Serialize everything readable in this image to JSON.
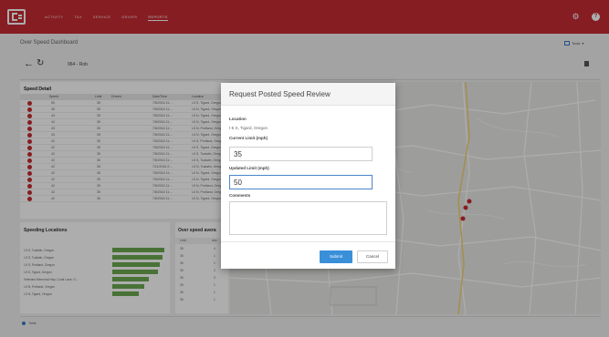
{
  "nav": {
    "items": [
      "ACTIVITY",
      "TAX",
      "SERVICE",
      "DRIVER",
      "REPORTS"
    ],
    "active": "REPORTS"
  },
  "page": {
    "title": "Over Speed Dashboard",
    "tools_label": "Tools",
    "vehicle": "964 - Rob"
  },
  "speed_detail": {
    "title": "Speed Detail",
    "columns": [
      "Speed",
      "Limit",
      "Drivers",
      "Date/Time",
      "Location"
    ],
    "rows": [
      {
        "speed": "50",
        "limit": "35",
        "driver": "",
        "datetime": "7/8/2016 11:...",
        "location": "I-5 S, Tigard, Oregon"
      },
      {
        "speed": "45",
        "limit": "35",
        "driver": "",
        "datetime": "7/8/2016 11:...",
        "location": "I-5 N, Tigard, Oregon"
      },
      {
        "speed": "44",
        "limit": "35",
        "driver": "",
        "datetime": "7/8/2016 11:...",
        "location": "I-5 N, Tigard, Oregon"
      },
      {
        "speed": "44",
        "limit": "35",
        "driver": "",
        "datetime": "7/8/2016 11:...",
        "location": "I-5 N, Tigard, Oregon"
      },
      {
        "speed": "43",
        "limit": "35",
        "driver": "",
        "datetime": "7/8/2016 11:...",
        "location": "I-5 N, Portland, Oregon"
      },
      {
        "speed": "43",
        "limit": "35",
        "driver": "",
        "datetime": "7/8/2016 11:...",
        "location": "I-5 N, Tigard, Oregon"
      },
      {
        "speed": "42",
        "limit": "35",
        "driver": "",
        "datetime": "7/8/2016 11:...",
        "location": "I-5 S, Portland, Oregon"
      },
      {
        "speed": "42",
        "limit": "35",
        "driver": "",
        "datetime": "7/8/2016 11:...",
        "location": "I-5 S, Tigard, Oregon"
      },
      {
        "speed": "42",
        "limit": "35",
        "driver": "",
        "datetime": "7/8/2016 11:...",
        "location": "I-5 S, Tualatin, Oregon"
      },
      {
        "speed": "42",
        "limit": "35",
        "driver": "",
        "datetime": "7/8/2016 11:...",
        "location": "I-5 S, Tualatin, Oregon"
      },
      {
        "speed": "42",
        "limit": "35",
        "driver": "",
        "datetime": "7/11/2016 2:...",
        "location": "I-5 N, Tualatin, Oregon"
      },
      {
        "speed": "42",
        "limit": "35",
        "driver": "",
        "datetime": "7/8/2016 11:...",
        "location": "I-5 N, Tigard, Oregon"
      },
      {
        "speed": "42",
        "limit": "35",
        "driver": "",
        "datetime": "7/8/2016 11:...",
        "location": "I-5 N, Tigard, Oregon"
      },
      {
        "speed": "42",
        "limit": "35",
        "driver": "",
        "datetime": "7/8/2016 11:...",
        "location": "I-5 N, Portland, Oregon"
      },
      {
        "speed": "42",
        "limit": "35",
        "driver": "",
        "datetime": "7/8/2016 11:...",
        "location": "I-5 N, Portland, Oregon"
      },
      {
        "speed": "42",
        "limit": "35",
        "driver": "",
        "datetime": "7/8/2016 11:...",
        "location": "I-5 N, Tigard, Oregon"
      }
    ]
  },
  "speeding_locations": {
    "title": "Speeding Locations",
    "items": [
      {
        "label": "I-5 S, Tualatin, Oregon",
        "value": 1.0
      },
      {
        "label": "I-5 S, Tualatin, Oregon",
        "value": 0.96
      },
      {
        "label": "I-5 S, Portland, Oregon",
        "value": 0.92
      },
      {
        "label": "I-5 S, Tigard, Oregon",
        "value": 0.88
      },
      {
        "label": "Veterans Memorial Hwy, Coral Lane, O...",
        "value": 0.7
      },
      {
        "label": "I-5 N, Portland, Oregon",
        "value": 0.62
      },
      {
        "label": "I-5 N, Tigard, Oregon",
        "value": 0.5
      }
    ]
  },
  "over_speed": {
    "title": "Over speed avera",
    "columns": [
      "Limit",
      "Ave"
    ],
    "rows": [
      {
        "limit": "35",
        "avg": "4"
      },
      {
        "limit": "35",
        "avg": "1"
      },
      {
        "limit": "35",
        "avg": "1"
      },
      {
        "limit": "35",
        "avg": "2"
      },
      {
        "limit": "35",
        "avg": "3"
      },
      {
        "limit": "35",
        "avg": "1"
      },
      {
        "limit": "35",
        "avg": "1"
      },
      {
        "limit": "35",
        "avg": "1"
      }
    ]
  },
  "footer": {
    "legend_label": "Total"
  },
  "modal": {
    "title": "Request Posted Speed Review",
    "location_label": "Location",
    "location_value": "I-5 S, Tigard, Oregon",
    "current_limit_label": "Current Limit (mph)",
    "current_limit_value": "35",
    "updated_limit_label": "Updated Limit (mph)",
    "updated_limit_value": "50",
    "comments_label": "Comments",
    "comments_value": "",
    "submit_label": "Submit",
    "cancel_label": "Cancel"
  },
  "colors": {
    "brand": "#c62b33",
    "speed_dot": "#c62b33",
    "bar": "#6ca852",
    "primary_button": "#3a8fd9"
  },
  "icons": [
    "logo-icon",
    "gear-icon",
    "help-icon",
    "back-arrow-icon",
    "refresh-icon",
    "flag-icon",
    "tools-icon",
    "resize-grip-icon"
  ]
}
